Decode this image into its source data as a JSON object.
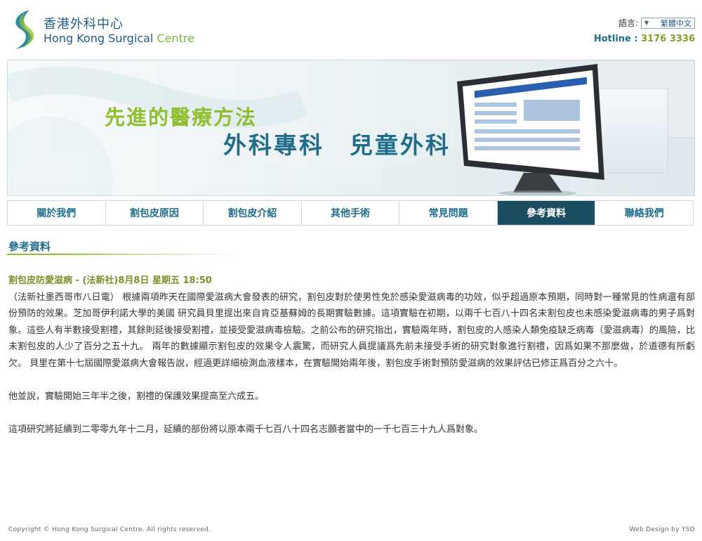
{
  "brand": {
    "name_zh": "香港外科中心",
    "name_en_main": "Hong Kong Surgical ",
    "name_en_accent": "Centre"
  },
  "language": {
    "label": "語言:",
    "selected": "繁體中文"
  },
  "hotline": {
    "label": "Hotline : ",
    "number": "3176 3336"
  },
  "banner": {
    "tagline1": "先進的醫療方法",
    "tagline2": "外科專科　兒童外科"
  },
  "nav": {
    "items": [
      {
        "label": "關於我們"
      },
      {
        "label": "割包皮原因"
      },
      {
        "label": "割包皮介紹"
      },
      {
        "label": "其他手術"
      },
      {
        "label": "常見問題"
      },
      {
        "label": "參考資料"
      },
      {
        "label": "聯絡我們"
      }
    ],
    "active_index": 5
  },
  "section": {
    "title": "參考資料"
  },
  "article": {
    "title": "割包皮防愛滋病 - (法新社)8月8日 星期五 18:50",
    "paragraphs": [
      "（法新社墨西哥市八日電） 根據兩項昨天在國際愛滋病大會發表的研究，割包皮對於使男性免於感染愛滋病毒的功效，似乎超過原本預期，同時對一種常見的性病還有部份預防的效果。芝加哥伊利諾大學的美國 研究員貝里提出來自肯亞基蘇姆的長期實驗數據。這項實驗在初期，以兩千七百八十四名未割包皮也未感染愛滋病毒的男子爲對象。這些人有半數接受割禮，其餘則延後接受割禮，並接受愛滋病毒檢驗。之前公布的研究指出，實驗兩年時，割包皮的人感染人類免疫缺乏病毒（愛滋病毒）的風險，比未割包皮的人少了百分之五十九。 兩年的數據顯示割包皮的效果令人震驚，而研究人員提議爲先前未接受手術的研究對象進行割禮，因爲如果不那麼做，於道德有所虧欠。 貝里在第十七屆國際愛滋病大會報告說，經過更詳細檢測血液樣本，在實驗開始兩年後，割包皮手術對預防愛滋病的效果評估已修正爲百分之六十。",
      "他並說，實驗開始三年半之後，割禮的保護效果提高至六成五。",
      "這項研究將延續到二零零九年十二月，延續的部份將以原本兩千七百八十四名志願者當中的一千七百三十九人爲對象。"
    ]
  },
  "footer": {
    "copyright": "Copyright © Hong Kong Surgical Centre. All rights reserved.",
    "credit": "Web Design by YSD"
  }
}
